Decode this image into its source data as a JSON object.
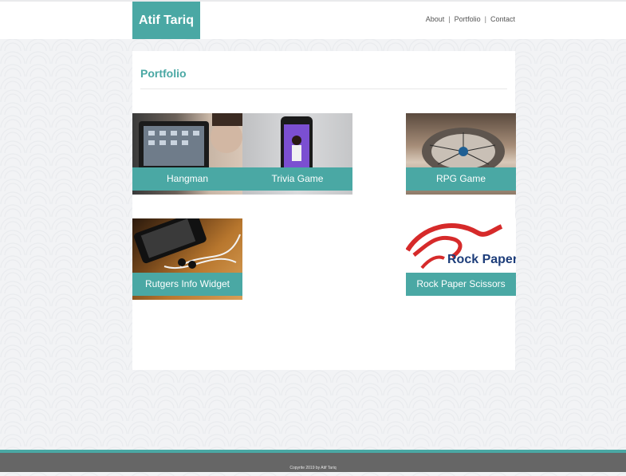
{
  "header": {
    "brand": "Atif Tariq",
    "nav": [
      {
        "label": "About"
      },
      {
        "label": "Portfolio"
      },
      {
        "label": "Contact"
      }
    ],
    "separator": "|"
  },
  "main": {
    "title": "Portfolio",
    "tiles": [
      {
        "label": "Hangman"
      },
      {
        "label": "Trivia Game"
      },
      {
        "label": "RPG Game"
      },
      {
        "label": "Rutgers Info Widget"
      },
      {
        "label": "Rock Paper Scissors"
      }
    ],
    "rps_logo_text": "Rock Paper"
  },
  "footer": {
    "copyright": "Copyrite 2019 by Atif Tariq"
  },
  "colors": {
    "accent": "#4aa8a4",
    "footer": "#666666",
    "background": "#f2f3f5"
  }
}
